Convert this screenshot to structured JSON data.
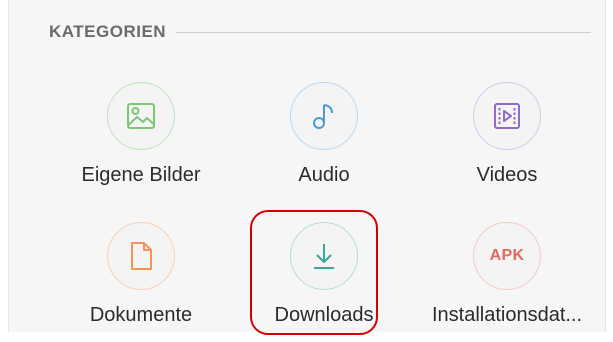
{
  "section": {
    "title": "KATEGORIEN"
  },
  "categories": [
    {
      "label": "Eigene Bilder",
      "icon": "image-icon",
      "color": "#7cc776"
    },
    {
      "label": "Audio",
      "icon": "music-note-icon",
      "color": "#4a9bd8"
    },
    {
      "label": "Videos",
      "icon": "video-icon",
      "color": "#8e6cc7"
    },
    {
      "label": "Dokumente",
      "icon": "document-icon",
      "color": "#f0945a"
    },
    {
      "label": "Downloads",
      "icon": "download-icon",
      "color": "#3aa69a"
    },
    {
      "label": "Installationsdat...",
      "icon": "apk-icon",
      "icon_text": "APK",
      "color": "#e06a5b"
    }
  ],
  "colors": {
    "highlight": "#d50000"
  }
}
